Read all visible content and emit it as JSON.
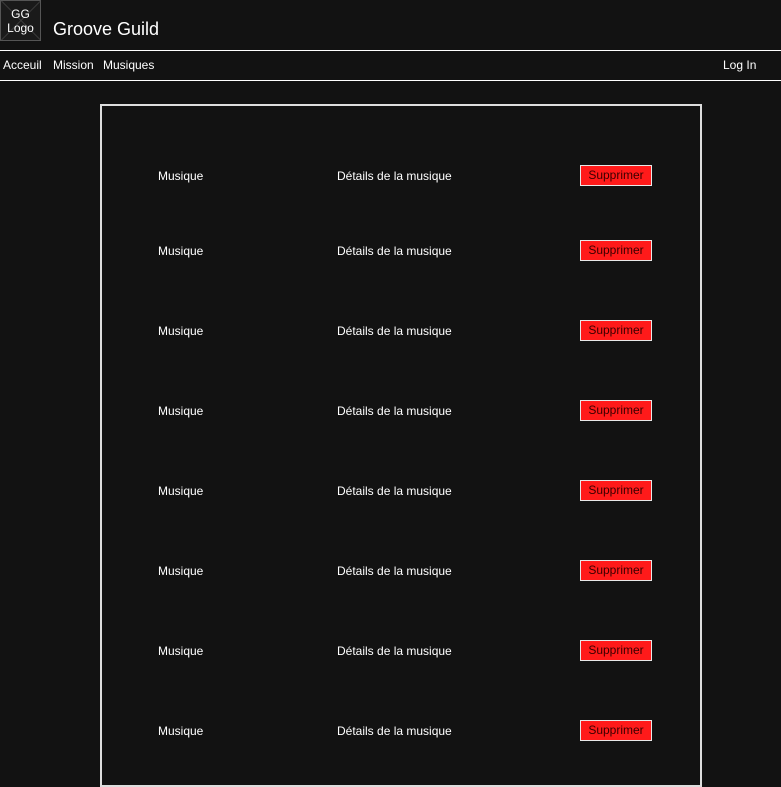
{
  "header": {
    "logo_line1": "GG",
    "logo_line2": "Logo",
    "brand": "Groove Guild"
  },
  "nav": {
    "home": "Acceuil",
    "mission": "Mission",
    "music": "Musiques",
    "login": "Log In"
  },
  "colors": {
    "background": "#121212",
    "text": "#ffffff",
    "delete_button": "#ff1a1a"
  },
  "music_list": [
    {
      "title": "Musique",
      "details": "Détails de la musique",
      "delete_label": "Supprimer"
    },
    {
      "title": "Musique",
      "details": "Détails de la musique",
      "delete_label": "Supprimer"
    },
    {
      "title": "Musique",
      "details": "Détails de la musique",
      "delete_label": "Supprimer"
    },
    {
      "title": "Musique",
      "details": "Détails de la musique",
      "delete_label": "Supprimer"
    },
    {
      "title": "Musique",
      "details": "Détails de la musique",
      "delete_label": "Supprimer"
    },
    {
      "title": "Musique",
      "details": "Détails de la musique",
      "delete_label": "Supprimer"
    },
    {
      "title": "Musique",
      "details": "Détails de la musique",
      "delete_label": "Supprimer"
    },
    {
      "title": "Musique",
      "details": "Détails de la musique",
      "delete_label": "Supprimer"
    }
  ]
}
